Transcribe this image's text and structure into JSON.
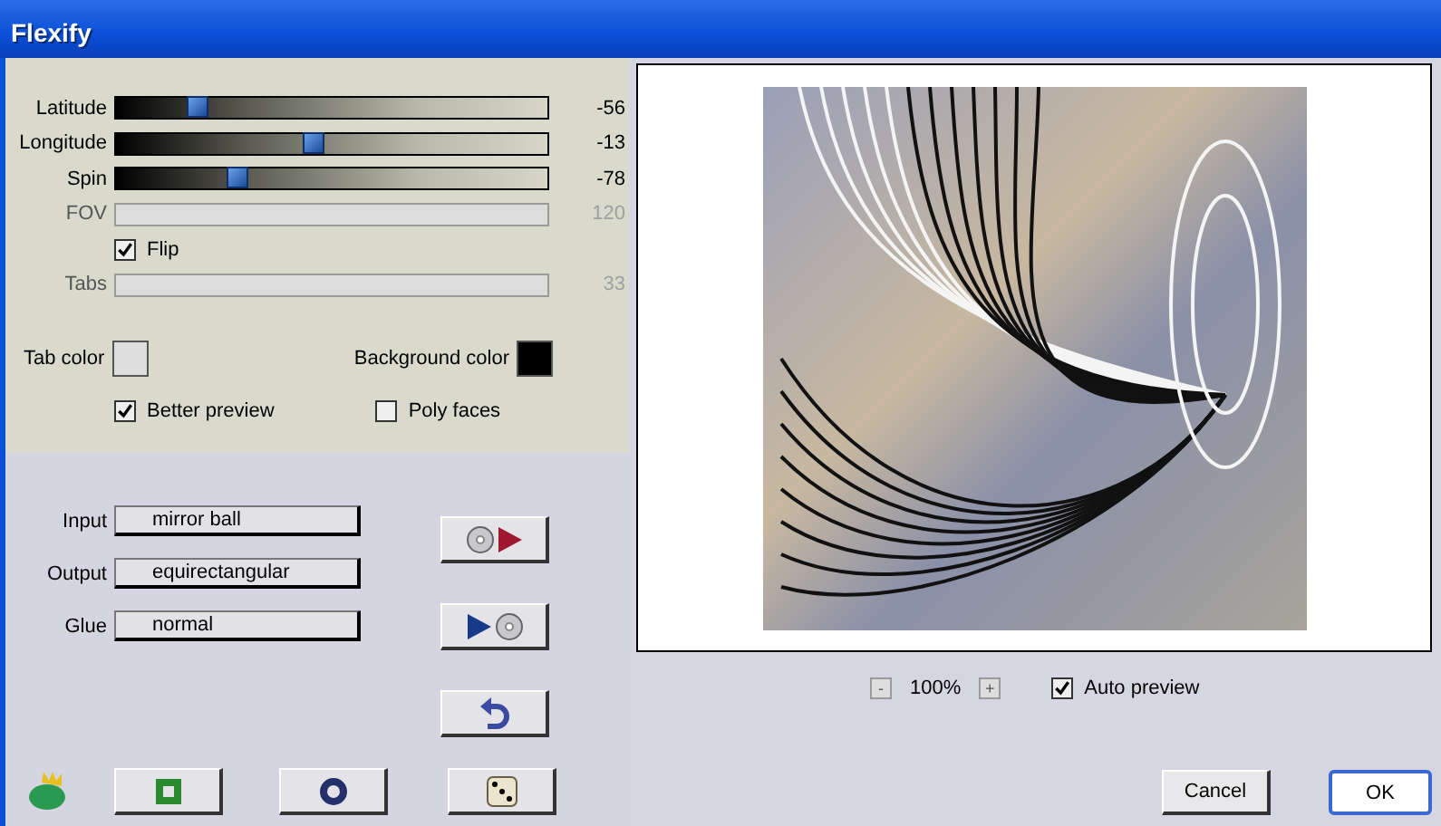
{
  "window": {
    "title": "Flexify"
  },
  "sliders": [
    {
      "label": "Latitude",
      "value": "-56",
      "level": 0.19,
      "disabled": false
    },
    {
      "label": "Longitude",
      "value": "-13",
      "level": 0.46,
      "disabled": false
    },
    {
      "label": "Spin",
      "value": "-78",
      "level": 0.28,
      "disabled": false
    },
    {
      "label": "FOV",
      "value": "120",
      "disabled": true
    }
  ],
  "flip": {
    "label": "Flip",
    "checked": true
  },
  "tabs_slider": {
    "label": "Tabs",
    "value": "33",
    "disabled": true
  },
  "color_pickers": [
    {
      "label": "Tab color",
      "color": "#dedede"
    },
    {
      "label": "Background color",
      "color": "#000000"
    }
  ],
  "options": [
    {
      "label": "Better preview",
      "checked": true
    },
    {
      "label": "Poly faces",
      "checked": false
    }
  ],
  "mappings": [
    {
      "label": "Input",
      "value": "mirror ball"
    },
    {
      "label": "Output",
      "value": "equirectangular"
    },
    {
      "label": "Glue",
      "value": "normal"
    }
  ],
  "zoom": {
    "minus": "-",
    "value": "100%",
    "plus": "+"
  },
  "auto_preview": {
    "label": "Auto preview",
    "checked": true
  },
  "buttons": [
    {
      "label": "Cancel",
      "default": false
    },
    {
      "label": "OK",
      "default": true
    }
  ]
}
